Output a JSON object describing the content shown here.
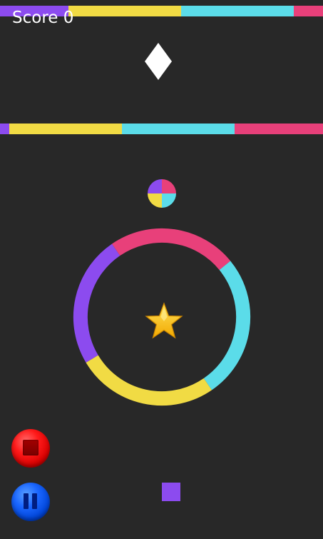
{
  "score": {
    "label": "Score 0"
  },
  "colors": {
    "background": "#282828",
    "purple": "#8c4bef",
    "yellow": "#f1db44",
    "cyan": "#5bdce9",
    "pink": "#e8407a",
    "white": "#ffffff"
  },
  "icons": {
    "collectible": "diamond-icon",
    "color_switcher": "color-switcher-icon",
    "star": "star-icon",
    "player": "player-square",
    "stop": "stop-icon",
    "pause": "pause-icon"
  },
  "obstacles": {
    "top_bar_colors": [
      "purple",
      "yellow",
      "cyan",
      "pink"
    ],
    "mid_bar_colors": [
      "purple",
      "yellow",
      "cyan",
      "pink"
    ],
    "ring_colors": [
      "pink",
      "cyan",
      "yellow",
      "purple"
    ]
  }
}
